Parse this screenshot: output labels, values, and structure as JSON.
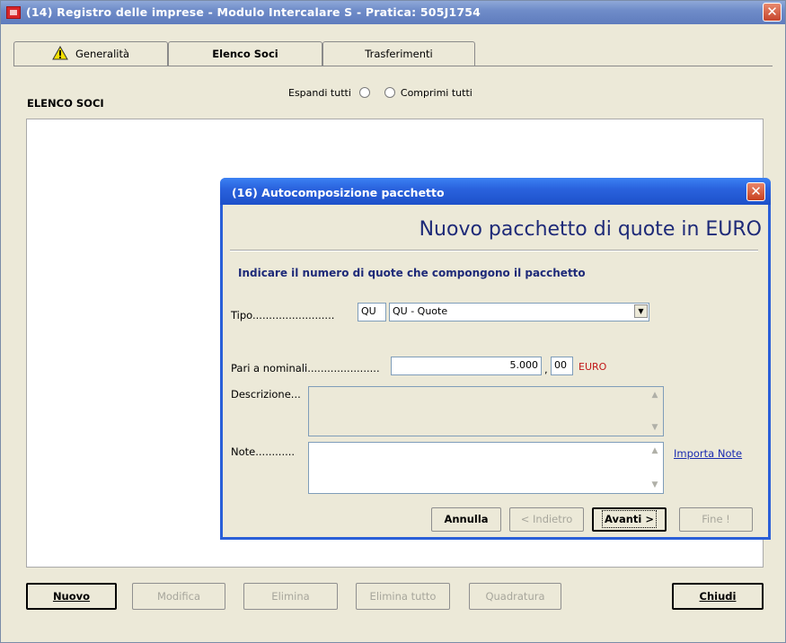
{
  "window": {
    "title": "(14) Registro delle imprese - Modulo Intercalare S - Pratica: 505J1754",
    "close": "✕"
  },
  "tabs": [
    {
      "label": "Generalità"
    },
    {
      "label": "Elenco Soci"
    },
    {
      "label": "Trasferimenti"
    }
  ],
  "section": {
    "label": "ELENCO SOCI",
    "expand_all": "Espandi tutti",
    "collapse_all": "Comprimi tutti"
  },
  "buttons": {
    "nuovo": "Nuovo",
    "modifica": "Modifica",
    "elimina": "Elimina",
    "elimina_tutto": "Elimina tutto",
    "quadratura": "Quadratura",
    "chiudi": "Chiudi"
  },
  "dialog": {
    "title": "(16) Autocomposizione pacchetto",
    "close": "✕",
    "heading": "Nuovo pacchetto di quote in EURO",
    "instruction": "Indicare il numero di quote che compongono il pacchetto",
    "tipo_label": "Tipo.........................",
    "tipo_code": "QU",
    "tipo_value": "QU - Quote",
    "pari_label": "Pari a  nominali......................",
    "pari_value": "5.000",
    "comma": ",",
    "pari_decimals": "00",
    "currency": "EURO",
    "descrizione_label": "Descrizione...",
    "descrizione_value": "",
    "note_label": "Note............",
    "note_value": "",
    "importa_note": "Importa Note",
    "btn_annulla": "Annulla",
    "btn_indietro": "< Indietro",
    "btn_avanti": "Avanti >",
    "btn_fine": "Fine !"
  },
  "colors": {
    "title_active": "#2a63de",
    "heading": "#1e2a78",
    "currency": "#c01818",
    "link": "#1a2bb0"
  }
}
